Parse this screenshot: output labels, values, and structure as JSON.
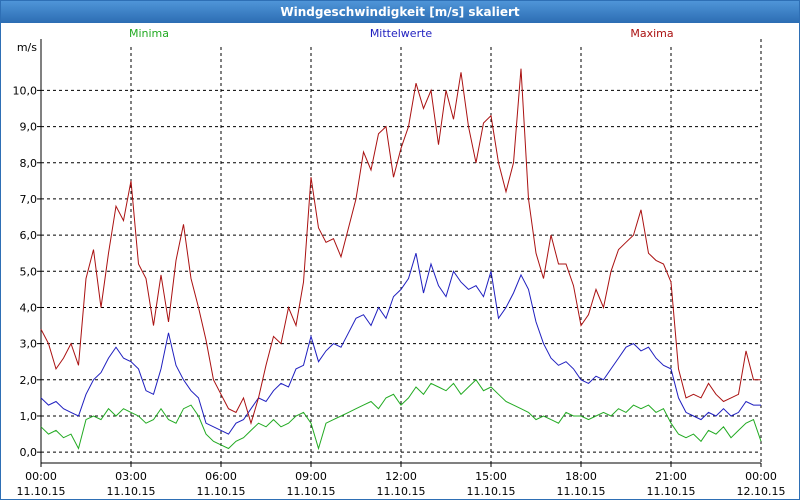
{
  "window": {
    "title": "Windgeschwindigkeit [m/s] skaliert"
  },
  "chart_data": {
    "type": "line",
    "title": "Windgeschwindigkeit [m/s] skaliert",
    "ylabel": "m/s",
    "ylim": [
      -0.3,
      11.2
    ],
    "grid": true,
    "legend_position": "top",
    "x_hours": [
      0,
      0.25,
      0.5,
      0.75,
      1,
      1.25,
      1.5,
      1.75,
      2,
      2.25,
      2.5,
      2.75,
      3,
      3.25,
      3.5,
      3.75,
      4,
      4.25,
      4.5,
      4.75,
      5,
      5.25,
      5.5,
      5.75,
      6,
      6.25,
      6.5,
      6.75,
      7,
      7.25,
      7.5,
      7.75,
      8,
      8.25,
      8.5,
      8.75,
      9,
      9.25,
      9.5,
      9.75,
      10,
      10.25,
      10.5,
      10.75,
      11,
      11.25,
      11.5,
      11.75,
      12,
      12.25,
      12.5,
      12.75,
      13,
      13.25,
      13.5,
      13.75,
      14,
      14.25,
      14.5,
      14.75,
      15,
      15.25,
      15.5,
      15.75,
      16,
      16.25,
      16.5,
      16.75,
      17,
      17.25,
      17.5,
      17.75,
      18,
      18.25,
      18.5,
      18.75,
      19,
      19.25,
      19.5,
      19.75,
      20,
      20.25,
      20.5,
      20.75,
      21,
      21.25,
      21.5,
      21.75,
      22,
      22.25,
      22.5,
      22.75,
      23,
      23.25,
      23.5,
      23.75,
      24
    ],
    "x_ticks": [
      {
        "time": "00:00",
        "date": "11.10.15",
        "hour": 0
      },
      {
        "time": "03:00",
        "date": "11.10.15",
        "hour": 3
      },
      {
        "time": "06:00",
        "date": "11.10.15",
        "hour": 6
      },
      {
        "time": "09:00",
        "date": "11.10.15",
        "hour": 9
      },
      {
        "time": "12:00",
        "date": "11.10.15",
        "hour": 12
      },
      {
        "time": "15:00",
        "date": "11.10.15",
        "hour": 15
      },
      {
        "time": "18:00",
        "date": "11.10.15",
        "hour": 18
      },
      {
        "time": "21:00",
        "date": "11.10.15",
        "hour": 21
      },
      {
        "time": "00:00",
        "date": "12.10.15",
        "hour": 24
      }
    ],
    "y_ticks": [
      {
        "label": "0,0",
        "value": 0
      },
      {
        "label": "1,0",
        "value": 1
      },
      {
        "label": "2,0",
        "value": 2
      },
      {
        "label": "3,0",
        "value": 3
      },
      {
        "label": "4,0",
        "value": 4
      },
      {
        "label": "5,0",
        "value": 5
      },
      {
        "label": "6,0",
        "value": 6
      },
      {
        "label": "7,0",
        "value": 7
      },
      {
        "label": "8,0",
        "value": 8
      },
      {
        "label": "9,0",
        "value": 9
      },
      {
        "label": "10,0",
        "value": 10
      }
    ],
    "series": [
      {
        "name": "Minima",
        "color": "#22aa22",
        "legend_pos": "left",
        "values": [
          0.7,
          0.5,
          0.6,
          0.4,
          0.5,
          0.1,
          0.9,
          1.0,
          0.9,
          1.2,
          1.0,
          1.2,
          1.1,
          1.0,
          0.8,
          0.9,
          1.2,
          0.9,
          0.8,
          1.2,
          1.3,
          1.0,
          0.5,
          0.3,
          0.2,
          0.1,
          0.3,
          0.4,
          0.6,
          0.8,
          0.7,
          0.9,
          0.7,
          0.8,
          1.0,
          1.1,
          0.8,
          0.1,
          0.8,
          0.9,
          1.0,
          1.1,
          1.2,
          1.3,
          1.4,
          1.2,
          1.5,
          1.6,
          1.3,
          1.5,
          1.8,
          1.6,
          1.9,
          1.8,
          1.7,
          1.9,
          1.6,
          1.8,
          2.0,
          1.7,
          1.8,
          1.6,
          1.4,
          1.3,
          1.2,
          1.1,
          0.9,
          1.0,
          0.9,
          0.8,
          1.1,
          1.0,
          1.0,
          0.9,
          1.0,
          1.1,
          1.0,
          1.2,
          1.1,
          1.3,
          1.2,
          1.3,
          1.1,
          1.2,
          0.8,
          0.5,
          0.4,
          0.5,
          0.3,
          0.6,
          0.5,
          0.7,
          0.4,
          0.6,
          0.8,
          0.9,
          0.3
        ]
      },
      {
        "name": "Mittelwerte",
        "color": "#1f1fbf",
        "legend_pos": "center",
        "values": [
          1.5,
          1.3,
          1.4,
          1.2,
          1.1,
          1.0,
          1.6,
          2.0,
          2.2,
          2.6,
          2.9,
          2.6,
          2.5,
          2.3,
          1.7,
          1.6,
          2.3,
          3.3,
          2.4,
          2.0,
          1.7,
          1.5,
          0.8,
          0.7,
          0.6,
          0.5,
          0.8,
          0.9,
          1.2,
          1.5,
          1.4,
          1.7,
          1.9,
          1.8,
          2.3,
          2.4,
          3.2,
          2.5,
          2.8,
          3.0,
          2.9,
          3.3,
          3.7,
          3.8,
          3.5,
          4.0,
          3.7,
          4.3,
          4.5,
          4.8,
          5.5,
          4.4,
          5.2,
          4.6,
          4.3,
          5.0,
          4.7,
          4.5,
          4.6,
          4.3,
          5.0,
          3.7,
          4.0,
          4.4,
          4.9,
          4.5,
          3.6,
          3.0,
          2.6,
          2.4,
          2.5,
          2.3,
          2.0,
          1.9,
          2.1,
          2.0,
          2.3,
          2.6,
          2.9,
          3.0,
          2.8,
          2.9,
          2.6,
          2.4,
          2.3,
          1.5,
          1.1,
          1.0,
          0.9,
          1.1,
          1.0,
          1.2,
          1.0,
          1.1,
          1.4,
          1.3,
          1.3
        ]
      },
      {
        "name": "Maxima",
        "color": "#aa1111",
        "legend_pos": "right",
        "values": [
          3.4,
          3.0,
          2.3,
          2.6,
          3.0,
          2.4,
          4.8,
          5.6,
          4.0,
          5.5,
          6.8,
          6.4,
          7.5,
          5.2,
          4.8,
          3.5,
          4.9,
          3.6,
          5.3,
          6.3,
          4.8,
          4.0,
          3.1,
          2.0,
          1.6,
          1.2,
          1.1,
          1.5,
          0.8,
          1.5,
          2.4,
          3.2,
          3.0,
          4.0,
          3.5,
          4.7,
          7.6,
          6.2,
          5.8,
          5.9,
          5.4,
          6.2,
          7.0,
          8.3,
          7.8,
          8.8,
          9.0,
          7.6,
          8.4,
          9.0,
          10.2,
          9.5,
          10.0,
          8.5,
          10.0,
          9.2,
          10.5,
          9.0,
          8.0,
          9.1,
          9.3,
          8.0,
          7.2,
          8.0,
          10.6,
          7.0,
          5.5,
          4.8,
          6.0,
          5.2,
          5.2,
          4.6,
          3.5,
          3.8,
          4.5,
          4.0,
          5.0,
          5.6,
          5.8,
          6.0,
          6.7,
          5.5,
          5.3,
          5.2,
          4.7,
          2.3,
          1.5,
          1.6,
          1.5,
          1.9,
          1.6,
          1.4,
          1.5,
          1.6,
          2.8,
          2.0,
          2.0
        ]
      }
    ]
  }
}
